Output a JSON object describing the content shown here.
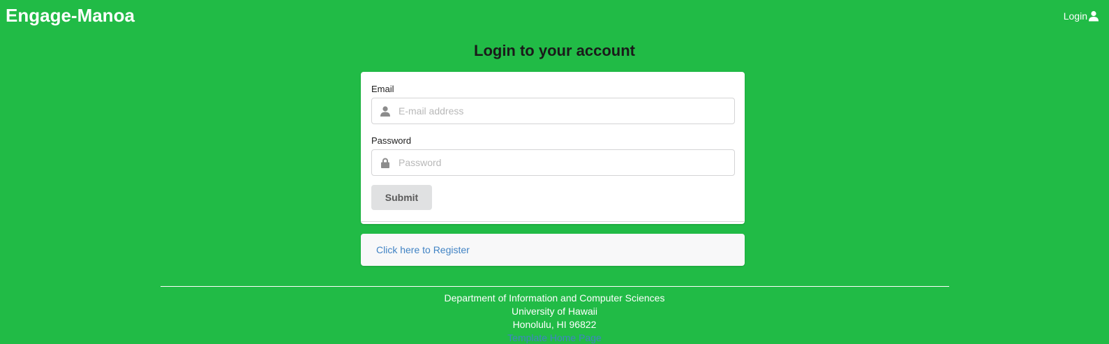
{
  "navbar": {
    "brand": "Engage-Manoa",
    "login_label": "Login",
    "login_icon": "user-icon"
  },
  "page": {
    "title": "Login to your account"
  },
  "form": {
    "email_label": "Email",
    "email_placeholder": "E-mail address",
    "email_icon": "user-icon",
    "password_label": "Password",
    "password_placeholder": "Password",
    "password_icon": "lock-icon",
    "submit_label": "Submit"
  },
  "register": {
    "link_text": "Click here to Register"
  },
  "footer": {
    "line1": "Department of Information and Computer Sciences",
    "line2": "University of Hawaii",
    "line3": "Honolulu, HI 96822",
    "link": "Template Home Page"
  },
  "colors": {
    "background": "#21bb46",
    "link": "#4183c4",
    "button": "#e0e1e2"
  }
}
